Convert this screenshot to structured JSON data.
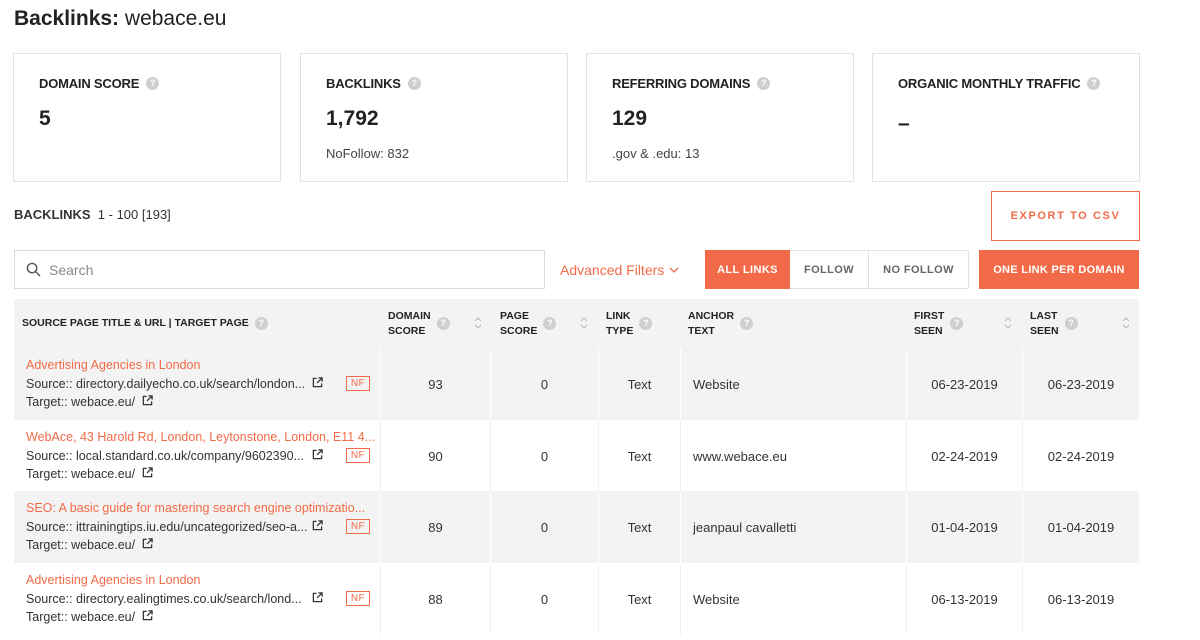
{
  "page": {
    "title_bold": "Backlinks:",
    "title_domain": "webace.eu"
  },
  "cards": [
    {
      "label": "DOMAIN SCORE",
      "value": "5",
      "sub": ""
    },
    {
      "label": "BACKLINKS",
      "value": "1,792",
      "sub": "NoFollow: 832"
    },
    {
      "label": "REFERRING DOMAINS",
      "value": "129",
      "sub": ".gov & .edu: 13"
    },
    {
      "label": "ORGANIC MONTHLY TRAFFIC",
      "value": "–",
      "sub": ""
    }
  ],
  "section": {
    "label": "BACKLINKS",
    "range": "1 - 100 [193]"
  },
  "export_label": "EXPORT TO CSV",
  "search": {
    "placeholder": "Search"
  },
  "advanced_filters": "Advanced Filters",
  "segments": {
    "all": "ALL LINKS",
    "follow": "FOLLOW",
    "nofollow": "NO FOLLOW",
    "active": "all"
  },
  "one_link_label": "ONE LINK PER DOMAIN",
  "columns": {
    "source": "SOURCE PAGE TITLE & URL | TARGET PAGE",
    "domain_score_1": "DOMAIN",
    "domain_score_2": "SCORE",
    "page_score_1": "PAGE",
    "page_score_2": "SCORE",
    "link_type_1": "LINK",
    "link_type_2": "TYPE",
    "anchor_1": "ANCHOR",
    "anchor_2": "TEXT",
    "first_seen_1": "FIRST",
    "first_seen_2": "SEEN",
    "last_seen_1": "LAST",
    "last_seen_2": "SEEN"
  },
  "rows": [
    {
      "title": "Advertising Agencies in London",
      "source": "Source:: directory.dailyecho.co.uk/search/london...",
      "target": "Target:: webace.eu/",
      "badge": "NF",
      "domain_score": "93",
      "page_score": "0",
      "link_type": "Text",
      "anchor": "Website",
      "first_seen": "06-23-2019",
      "last_seen": "06-23-2019"
    },
    {
      "title": "WebAce, 43 Harold Rd, London, Leytonstone, London, E11 4...",
      "source": "Source:: local.standard.co.uk/company/9602390...",
      "target": "Target:: webace.eu/",
      "badge": "NF",
      "domain_score": "90",
      "page_score": "0",
      "link_type": "Text",
      "anchor": "www.webace.eu",
      "first_seen": "02-24-2019",
      "last_seen": "02-24-2019"
    },
    {
      "title": "SEO: A basic guide for mastering search engine optimizatio...",
      "source": "Source:: ittrainingtips.iu.edu/uncategorized/seo-a...",
      "target": "Target:: webace.eu/",
      "badge": "NF",
      "domain_score": "89",
      "page_score": "0",
      "link_type": "Text",
      "anchor": "jeanpaul cavalletti",
      "first_seen": "01-04-2019",
      "last_seen": "01-04-2019"
    },
    {
      "title": "Advertising Agencies in London",
      "source": "Source:: directory.ealingtimes.co.uk/search/lond...",
      "target": "Target:: webace.eu/",
      "badge": "NF",
      "domain_score": "88",
      "page_score": "0",
      "link_type": "Text",
      "anchor": "Website",
      "first_seen": "06-13-2019",
      "last_seen": "06-13-2019"
    }
  ]
}
